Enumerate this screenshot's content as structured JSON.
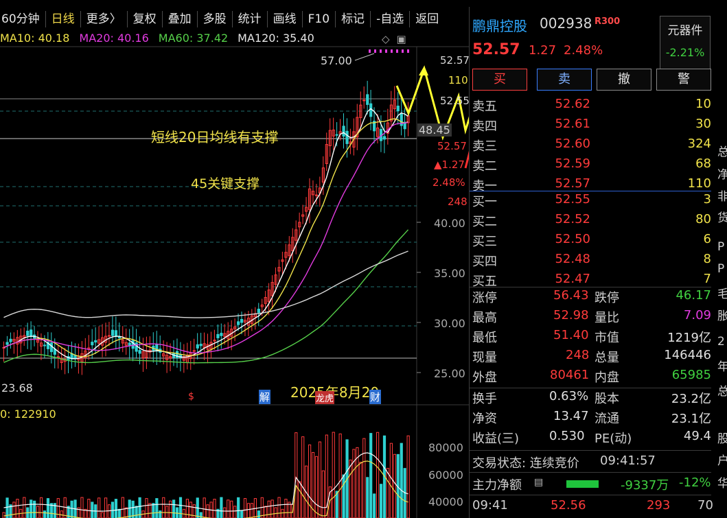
{
  "toolbar": {
    "items": [
      "60分钟",
      "日线",
      "更多〉",
      "复权",
      "叠加",
      "多股",
      "统计",
      "画线",
      "F10",
      "标记",
      "-自选",
      "返回"
    ],
    "active_index": 1
  },
  "ma_line": {
    "ma10": "MA10: 40.18",
    "ma20": "MA20: 40.16",
    "ma60": "MA60: 37.42",
    "ma120": "MA120: 35.40"
  },
  "chart_labels": {
    "high_label": "57.00",
    "low_label": "23.68",
    "annotation_support_ma20": "短线20日均线有支撑",
    "annotation_key_support": "45关键支撑",
    "annotation_date": "2025年8月20",
    "price_tag": "48.45",
    "marker_s": "$",
    "marker_jie": "解",
    "marker_lhb": "龙虎",
    "marker_cai": "财",
    "vol_label": "0: 122910"
  },
  "price_axis": {
    "labels": [
      "52.57",
      "110",
      "52.55",
      "40.00",
      "35.00",
      "30.00",
      "25.00"
    ],
    "quote_overlay": [
      "52.57",
      "▲1.27",
      "2.48%",
      "248"
    ]
  },
  "volume_axis": {
    "labels": [
      "80000",
      "60000",
      "40000"
    ]
  },
  "stock": {
    "name": "鹏鼎控股",
    "code": "002938",
    "tag": "R300",
    "sector_name": "元器件",
    "sector_pct": "-2.21%",
    "price": "52.57",
    "change": "1.27",
    "pct": "2.48%"
  },
  "buttons": {
    "buy": "买",
    "sell": "卖",
    "cancel": "撤",
    "alert": "警"
  },
  "asks": [
    {
      "label": "卖五",
      "price": "52.62",
      "vol": "10"
    },
    {
      "label": "卖四",
      "price": "52.61",
      "vol": "30"
    },
    {
      "label": "卖三",
      "price": "52.60",
      "vol": "324"
    },
    {
      "label": "卖二",
      "price": "52.59",
      "vol": "68"
    },
    {
      "label": "卖一",
      "price": "52.57",
      "vol": "110"
    }
  ],
  "bids": [
    {
      "label": "买一",
      "price": "52.55",
      "vol": "3"
    },
    {
      "label": "买二",
      "price": "52.52",
      "vol": "80"
    },
    {
      "label": "买三",
      "price": "52.50",
      "vol": "6"
    },
    {
      "label": "买四",
      "price": "52.48",
      "vol": "8"
    },
    {
      "label": "买五",
      "price": "52.47",
      "vol": "7"
    }
  ],
  "stats": {
    "limit_up_l": "涨停",
    "limit_up": "56.43",
    "limit_down_l": "跌停",
    "limit_down": "46.17",
    "high_l": "最高",
    "high": "52.98",
    "vol_ratio_l": "量比",
    "vol_ratio": "7.09",
    "low_l": "最低",
    "low": "51.40",
    "mktcap_l": "市值",
    "mktcap": "1219亿",
    "curvol_l": "现量",
    "curvol": "248",
    "totvol_l": "总量",
    "totvol": "146446",
    "outer_l": "外盘",
    "outer": "80461",
    "inner_l": "内盘",
    "inner": "65985",
    "turnover_l": "换手",
    "turnover": "0.63%",
    "equity_l": "股本",
    "equity": "23.2亿",
    "nav_l": "净资",
    "nav": "13.47",
    "float_l": "流通",
    "float": "23.1亿",
    "eps_l": "收益(三)",
    "eps": "0.530",
    "pe_l": "PE(动)",
    "pe": "49.4"
  },
  "status": {
    "label": "交易状态: 连续竞价",
    "time": "09:41:57"
  },
  "mainflow": {
    "label": "主力净额",
    "amount": "-9337万",
    "pct": "-12%"
  },
  "tick": {
    "time": "09:41",
    "price": "52.56",
    "vol": "293",
    "extra": "70"
  },
  "edge_chars": [
    "总",
    "净",
    "非",
    "货",
    "P",
    "P",
    "毛",
    "胀",
    "2",
    "年",
    "总",
    "股",
    "户",
    "华"
  ],
  "colors": {
    "up": "#ff3b3b",
    "down": "#40d040",
    "ma10": "#f0e24a",
    "ma20": "#e23be0",
    "ma60": "#56d04a",
    "ma120": "#d8d8d8",
    "arrow_yellow": "#ffff30",
    "arrow_red": "#ff3030"
  },
  "chart_data": {
    "type": "candlestick",
    "price_axis": {
      "ticks": [
        40.0,
        35.0,
        30.0,
        25.0
      ],
      "high": 57.0,
      "low": 23.68
    },
    "moving_averages": {
      "MA10": 40.18,
      "MA20": 40.16,
      "MA60": 37.42,
      "MA120": 35.4
    },
    "volume_axis": {
      "ticks": [
        80000,
        60000,
        40000
      ]
    }
  }
}
